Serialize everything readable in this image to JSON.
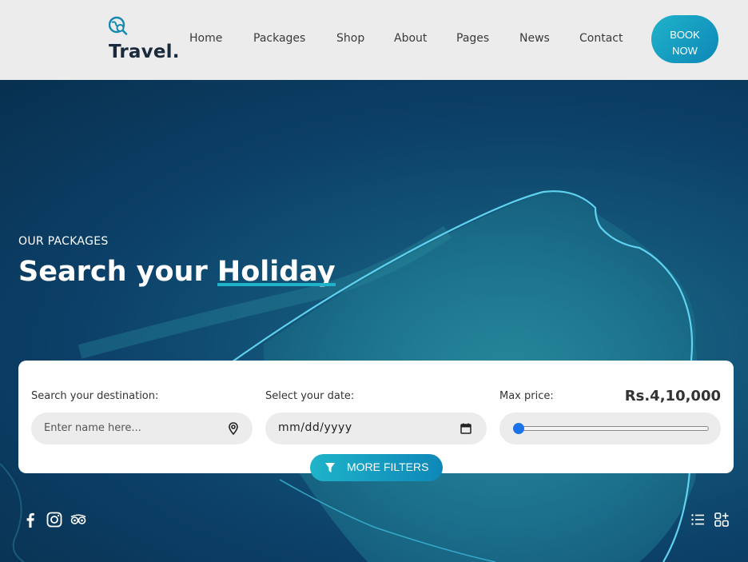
{
  "header": {
    "logo_text": "Travel.",
    "nav": [
      "Home",
      "Packages",
      "Shop",
      "About",
      "Pages",
      "News",
      "Contact"
    ],
    "book_line1": "BOOK",
    "book_line2": "NOW"
  },
  "hero": {
    "eyebrow": "OUR PACKAGES",
    "headline_part1": "Search your ",
    "headline_highlight": "Holiday"
  },
  "search": {
    "destination_label": "Search your destination:",
    "destination_placeholder": "Enter name here...",
    "date_label": "Select your date:",
    "date_value": "mm/dd/yyyy",
    "price_label": "Max price:",
    "price_value": "Rs.4,10,000",
    "price_slider_fraction": 0.0,
    "more_filters": "MORE FILTERS"
  },
  "icons": {
    "logo": "globe-search-icon",
    "location": "location-pin-icon",
    "calendar": "calendar-icon",
    "filter": "filter-icon",
    "social": [
      "facebook-icon",
      "instagram-icon",
      "tripadvisor-icon"
    ],
    "views": [
      "list-view-icon",
      "grid-view-icon"
    ]
  },
  "colors": {
    "accent": "#1fb3c9",
    "accent_dark": "#0e87b8",
    "header_bg": "#ececec",
    "slider_thumb": "#1a73e8"
  }
}
